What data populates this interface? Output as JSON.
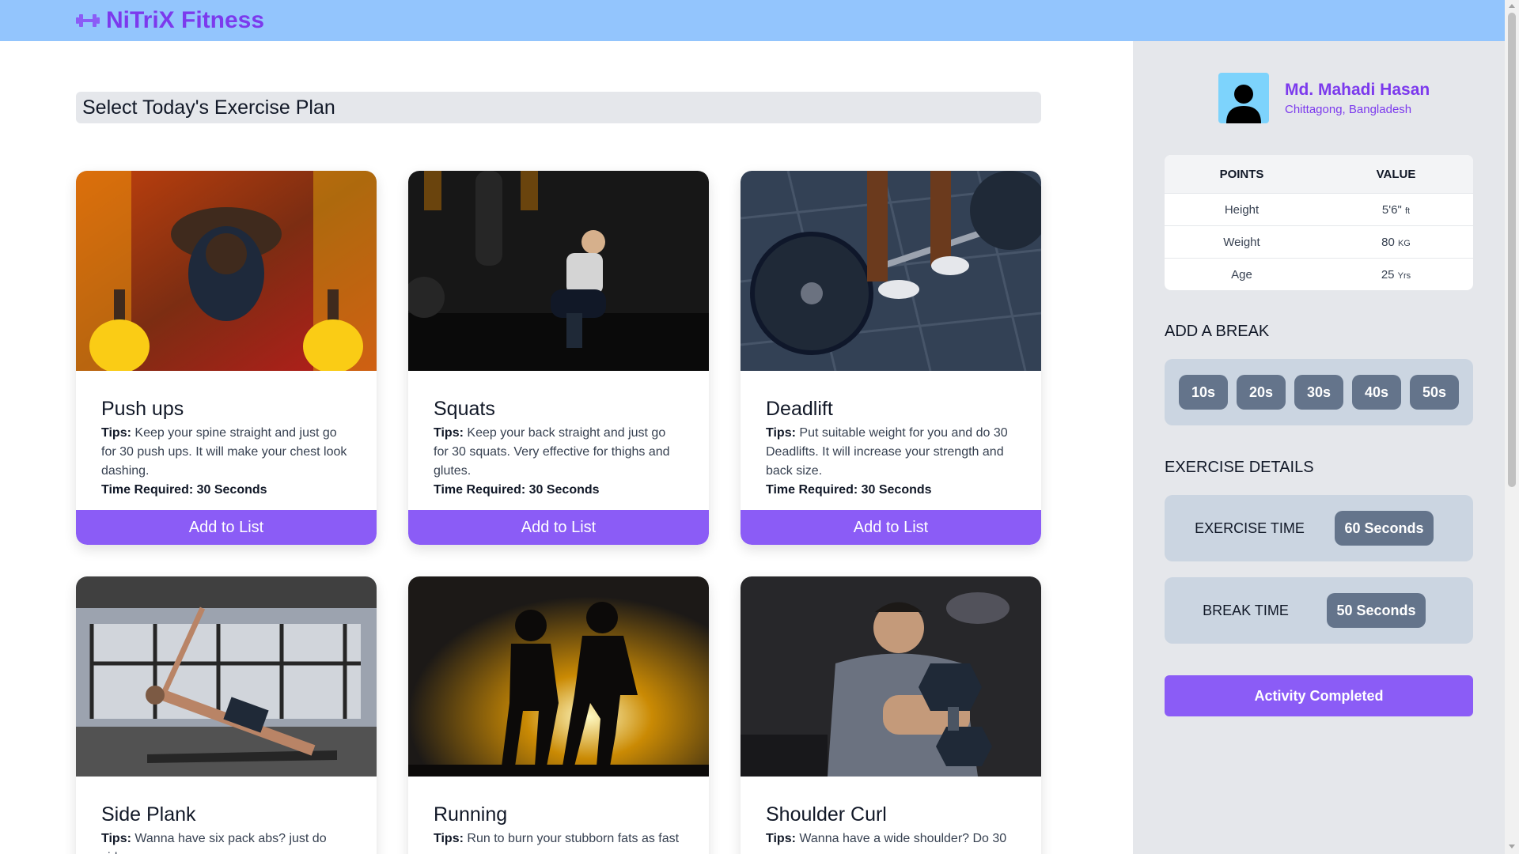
{
  "header": {
    "brand": "NiTriX Fitness",
    "logo_icon": "dumbbell-icon"
  },
  "main": {
    "title": "Select Today's Exercise Plan",
    "cards": [
      {
        "title": "Push ups",
        "tips_label": "Tips:",
        "tips": "Keep your spine straight and just go for 30 push ups. It will make your chest look dashing.",
        "time": "Time Required: 30 Seconds",
        "button": "Add to List"
      },
      {
        "title": "Squats",
        "tips_label": "Tips:",
        "tips": "Keep your back straight and just go for 30 squats. Very effective for thighs and glutes.",
        "time": "Time Required: 30 Seconds",
        "button": "Add to List"
      },
      {
        "title": "Deadlift",
        "tips_label": "Tips:",
        "tips": "Put suitable weight for you and do 30 Deadlifts. It will increase your strength and back size.",
        "time": "Time Required: 30 Seconds",
        "button": "Add to List"
      },
      {
        "title": "Side Plank",
        "tips_label": "Tips:",
        "tips": "Wanna have six pack abs? just do side"
      },
      {
        "title": "Running",
        "tips_label": "Tips:",
        "tips": "Run to burn your stubborn fats as fast"
      },
      {
        "title": "Shoulder Curl",
        "tips_label": "Tips:",
        "tips": "Wanna have a wide shoulder? Do 30"
      }
    ]
  },
  "sidebar": {
    "profile": {
      "name": "Md. Mahadi Hasan",
      "location": "Chittagong, Bangladesh"
    },
    "stats": {
      "headers": [
        "POINTS",
        "VALUE"
      ],
      "rows": [
        {
          "point": "Height",
          "value": "5'6\"",
          "unit": "ft"
        },
        {
          "point": "Weight",
          "value": "80",
          "unit": "KG"
        },
        {
          "point": "Age",
          "value": "25",
          "unit": "Yrs"
        }
      ]
    },
    "break_heading": "ADD A BREAK",
    "breaks": [
      "10s",
      "20s",
      "30s",
      "40s",
      "50s"
    ],
    "details_heading": "EXERCISE DETAILS",
    "exercise_time_label": "EXERCISE TIME",
    "exercise_time_value": "60 Seconds",
    "break_time_label": "BREAK TIME",
    "break_time_value": "50 Seconds",
    "complete_button": "Activity Completed"
  },
  "colors": {
    "header_bg": "#93c5fd",
    "accent": "#8b5cf6",
    "brand": "#7c3aed",
    "sidebar_bg": "#e5e7eb",
    "pill": "#64748b"
  }
}
